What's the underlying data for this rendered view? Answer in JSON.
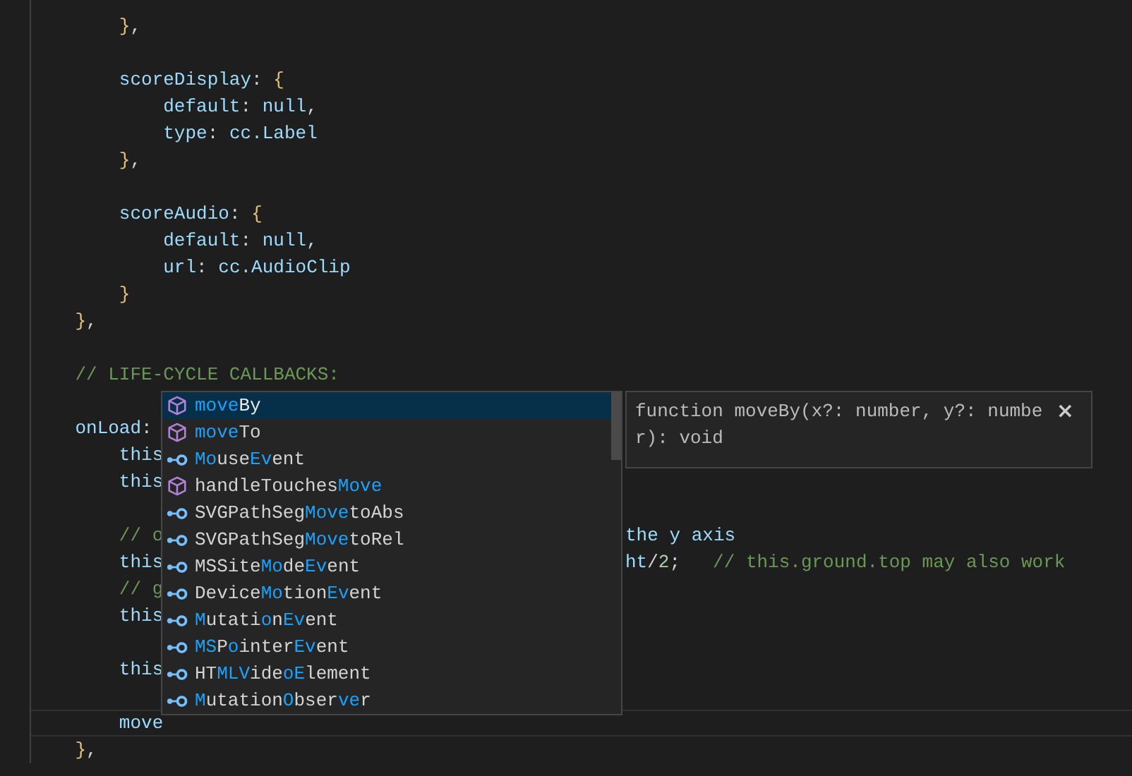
{
  "editor": {
    "lines": [
      {
        "text": "        },",
        "current": false
      },
      {
        "current": false
      },
      {
        "text": "        scoreDisplay: {",
        "current": false
      },
      {
        "text": "            default: null,",
        "current": false
      },
      {
        "text": "            type: cc.Label",
        "current": false
      },
      {
        "text": "        },",
        "current": false
      },
      {
        "current": false
      },
      {
        "text": "        scoreAudio: {",
        "current": false
      },
      {
        "text": "            default: null,",
        "current": false
      },
      {
        "text": "            url: cc.AudioClip",
        "current": false
      },
      {
        "text": "        }",
        "current": false
      },
      {
        "text": "    },",
        "current": false
      },
      {
        "current": false
      },
      {
        "text": "    // LIFE-CYCLE CALLBACKS:",
        "current": false
      },
      {
        "current": false
      },
      {
        "text": "    onLoad:",
        "current": false
      },
      {
        "text": "        this",
        "current": false
      },
      {
        "text": "        this",
        "current": false
      },
      {
        "current": false
      },
      {
        "text": "        // o",
        "tail": [
          "the y axis"
        ],
        "current": false
      },
      {
        "text": "        this",
        "tail": [
          "ht/2;",
          "// this.ground.top may also work"
        ],
        "current": false
      },
      {
        "text": "        // g",
        "current": false
      },
      {
        "text": "        this",
        "current": false
      },
      {
        "current": false
      },
      {
        "text": "        this",
        "current": false
      },
      {
        "current": false
      },
      {
        "text": "        move",
        "current": true
      },
      {
        "text": "    },",
        "current": false
      }
    ]
  },
  "suggestions": [
    {
      "kind": "method",
      "selected": true,
      "parts": [
        {
          "t": "move",
          "match": true
        },
        {
          "t": "By",
          "match": false
        }
      ]
    },
    {
      "kind": "method",
      "selected": false,
      "parts": [
        {
          "t": "move",
          "match": true
        },
        {
          "t": "To",
          "match": false
        }
      ]
    },
    {
      "kind": "field",
      "selected": false,
      "parts": [
        {
          "t": "Mo",
          "match": true
        },
        {
          "t": "use",
          "match": false
        },
        {
          "t": "Ev",
          "match": true
        },
        {
          "t": "ent",
          "match": false
        }
      ]
    },
    {
      "kind": "method",
      "selected": false,
      "parts": [
        {
          "t": "handleTouches",
          "match": false
        },
        {
          "t": "Move",
          "match": true
        }
      ]
    },
    {
      "kind": "field",
      "selected": false,
      "parts": [
        {
          "t": "SVGPathSeg",
          "match": false
        },
        {
          "t": "Move",
          "match": true
        },
        {
          "t": "toAbs",
          "match": false
        }
      ]
    },
    {
      "kind": "field",
      "selected": false,
      "parts": [
        {
          "t": "SVGPathSeg",
          "match": false
        },
        {
          "t": "Move",
          "match": true
        },
        {
          "t": "toRel",
          "match": false
        }
      ]
    },
    {
      "kind": "field",
      "selected": false,
      "parts": [
        {
          "t": "MSSite",
          "match": false
        },
        {
          "t": "Mo",
          "match": true
        },
        {
          "t": "de",
          "match": false
        },
        {
          "t": "Ev",
          "match": true
        },
        {
          "t": "ent",
          "match": false
        }
      ]
    },
    {
      "kind": "field",
      "selected": false,
      "parts": [
        {
          "t": "Device",
          "match": false
        },
        {
          "t": "Mo",
          "match": true
        },
        {
          "t": "tion",
          "match": false
        },
        {
          "t": "Ev",
          "match": true
        },
        {
          "t": "ent",
          "match": false
        }
      ]
    },
    {
      "kind": "field",
      "selected": false,
      "parts": [
        {
          "t": "M",
          "match": true
        },
        {
          "t": "utati",
          "match": false
        },
        {
          "t": "o",
          "match": true
        },
        {
          "t": "n",
          "match": false
        },
        {
          "t": "Ev",
          "match": true
        },
        {
          "t": "ent",
          "match": false
        }
      ]
    },
    {
      "kind": "field",
      "selected": false,
      "parts": [
        {
          "t": "MS",
          "match": true
        },
        {
          "t": "P",
          "match": false
        },
        {
          "t": "o",
          "match": true
        },
        {
          "t": "inter",
          "match": false
        },
        {
          "t": "Ev",
          "match": true
        },
        {
          "t": "ent",
          "match": false
        }
      ]
    },
    {
      "kind": "field",
      "selected": false,
      "parts": [
        {
          "t": "HT",
          "match": false
        },
        {
          "t": "MLV",
          "match": true
        },
        {
          "t": "ide",
          "match": false
        },
        {
          "t": "oE",
          "match": true
        },
        {
          "t": "lement",
          "match": false
        }
      ]
    },
    {
      "kind": "field",
      "selected": false,
      "parts": [
        {
          "t": "M",
          "match": true
        },
        {
          "t": "utation",
          "match": false
        },
        {
          "t": "O",
          "match": true
        },
        {
          "t": "bser",
          "match": false
        },
        {
          "t": "ve",
          "match": true
        },
        {
          "t": "r",
          "match": false
        }
      ]
    }
  ],
  "details": {
    "lines": [
      "function moveBy(x?: number, y?: numbe",
      "r): void"
    ],
    "close": "×"
  }
}
